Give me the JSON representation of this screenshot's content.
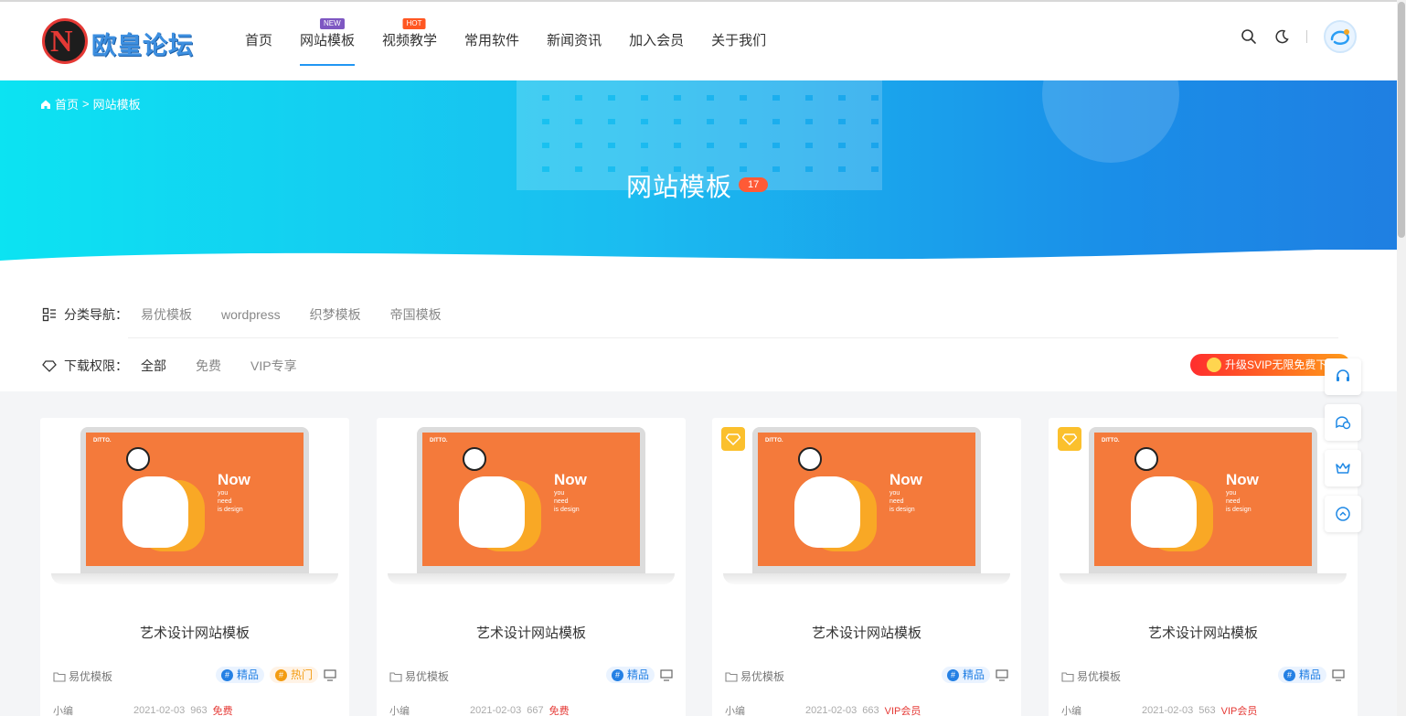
{
  "header": {
    "logo_text": "欧皇论坛",
    "nav": [
      {
        "label": "首页",
        "badge": ""
      },
      {
        "label": "网站模板",
        "badge": "NEW",
        "active": true
      },
      {
        "label": "视频教学",
        "badge": "HOT"
      },
      {
        "label": "常用软件",
        "badge": ""
      },
      {
        "label": "新闻资讯",
        "badge": ""
      },
      {
        "label": "加入会员",
        "badge": ""
      },
      {
        "label": "关于我们",
        "badge": ""
      }
    ],
    "icons": [
      "search-icon",
      "dark-mode-icon",
      "user-avatar"
    ]
  },
  "banner": {
    "breadcrumb_home": "首页",
    "breadcrumb_sep": ">",
    "breadcrumb_current": "网站模板",
    "title": "网站模板",
    "count": "17"
  },
  "filter": {
    "category_label": "分类导航：",
    "categories": [
      "易优模板",
      "wordpress",
      "织梦模板",
      "帝国模板"
    ],
    "permission_label": "下载权限：",
    "permissions": [
      "全部",
      "免费",
      "VIP专享"
    ],
    "svip_label": "升级SVIP无限免费下载"
  },
  "cards": [
    {
      "title": "艺术设计网站模板",
      "category": "易优模板",
      "tags": [
        "精品",
        "热门"
      ],
      "vip": false,
      "author": "小编",
      "date": "2021-02-03",
      "views": "963",
      "price": "免费",
      "screen_big": "Now",
      "screen_small": "you\nneed\nis design",
      "screen_brand": "DITTO."
    },
    {
      "title": "艺术设计网站模板",
      "category": "易优模板",
      "tags": [
        "精品"
      ],
      "vip": false,
      "author": "小编",
      "date": "2021-02-03",
      "views": "667",
      "price": "免费",
      "screen_big": "Now",
      "screen_small": "you\nneed\nis design",
      "screen_brand": "DITTO."
    },
    {
      "title": "艺术设计网站模板",
      "category": "易优模板",
      "tags": [
        "精品"
      ],
      "vip": true,
      "author": "小编",
      "date": "2021-02-03",
      "views": "663",
      "price": "VIP会员",
      "screen_big": "Now",
      "screen_small": "you\nneed\nis design",
      "screen_brand": "DITTO."
    },
    {
      "title": "艺术设计网站模板",
      "category": "易优模板",
      "tags": [
        "精品"
      ],
      "vip": true,
      "author": "小编",
      "date": "2021-02-03",
      "views": "563",
      "price": "VIP会员",
      "screen_big": "Now",
      "screen_small": "you\nneed\nis design",
      "screen_brand": "DITTO."
    }
  ],
  "colors": {
    "accent": "#2196f3",
    "banner_start": "#0ce3f2",
    "banner_end": "#1f7fe2",
    "badge_new": "#7e57c2",
    "badge_hot": "#ff5722",
    "vip": "#fbc02d"
  }
}
